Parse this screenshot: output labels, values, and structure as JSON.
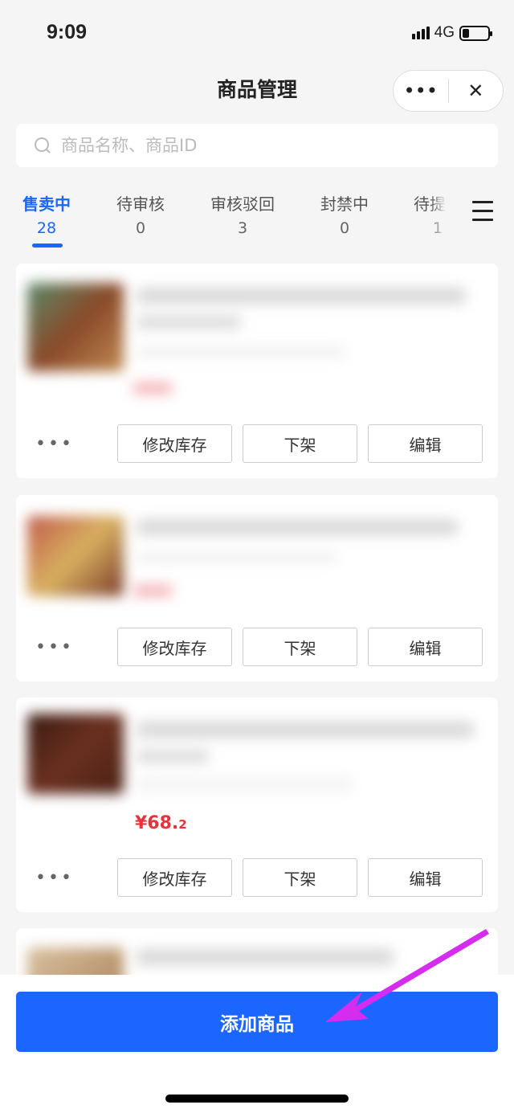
{
  "status_bar": {
    "time": "9:09",
    "network": "4G",
    "battery_icon": "battery-low-icon",
    "signal_icon": "signal-icon"
  },
  "header": {
    "title": "商品管理",
    "more_icon": "more-horizontal-icon",
    "close_icon": "close-icon",
    "more_label": "•••",
    "close_label": "✕"
  },
  "search": {
    "placeholder": "商品名称、商品ID",
    "icon": "search-icon"
  },
  "tabs": [
    {
      "label": "售卖中",
      "count": "28",
      "active": true
    },
    {
      "label": "待审核",
      "count": "0"
    },
    {
      "label": "审核驳回",
      "count": "3"
    },
    {
      "label": "封禁中",
      "count": "0"
    },
    {
      "label": "待提交",
      "count": "1"
    }
  ],
  "products": [
    {
      "price": "",
      "actions": {
        "more": "•••",
        "stock": "修改库存",
        "offshelf": "下架",
        "edit": "编辑"
      }
    },
    {
      "price": "",
      "actions": {
        "more": "•••",
        "stock": "修改库存",
        "offshelf": "下架",
        "edit": "编辑"
      }
    },
    {
      "price_main": "¥68.",
      "price_dec": "2",
      "actions": {
        "more": "•••",
        "stock": "修改库存",
        "offshelf": "下架",
        "edit": "编辑"
      }
    },
    {
      "price": ""
    }
  ],
  "footer": {
    "add_button": "添加商品"
  },
  "colors": {
    "accent": "#1a66ff",
    "price": "#e8323c",
    "annotation_arrow": "#d62cf0"
  }
}
